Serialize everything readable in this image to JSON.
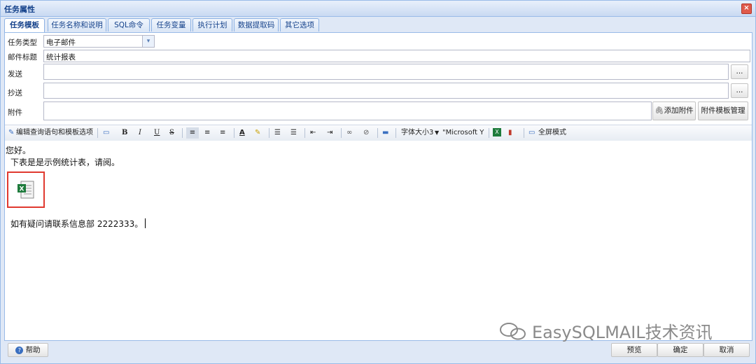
{
  "window": {
    "title": "任务属性",
    "close_icon": "close-icon"
  },
  "tabs": [
    {
      "label": "任务模板",
      "active": true
    },
    {
      "label": "任务名称和说明"
    },
    {
      "label": "SQL命令"
    },
    {
      "label": "任务变量"
    },
    {
      "label": "执行计划"
    },
    {
      "label": "数据提取码"
    },
    {
      "label": "其它选项"
    }
  ],
  "form": {
    "task_type_label": "任务类型",
    "task_type_value": "电子邮件",
    "subject_label": "邮件标题",
    "subject_value": "统计报表",
    "send_label": "发送",
    "send_value": "",
    "cc_label": "抄送",
    "cc_value": "",
    "attach_label": "附件",
    "attach_value": "",
    "browse_label": "...",
    "add_attachment_label": "添加附件",
    "attachment_template_label": "附件模板管理"
  },
  "toolbar": {
    "edit_query_label": "编辑查询语句和模板选项",
    "bold": "B",
    "italic": "I",
    "underline": "U",
    "strike": "S",
    "text_color": "A",
    "font_size_label": "字体大小3",
    "font_name_label": "\"Microsoft Y",
    "fullscreen_label": "全屏模式"
  },
  "editor": {
    "line1": "您好。",
    "line2": "下表是是示例统计表，请阅。",
    "line3": "如有疑问请联系信息部 2222333。"
  },
  "footer": {
    "help_label": "帮助",
    "preview_label": "预览",
    "ok_label": "确定",
    "cancel_label": "取消"
  },
  "watermark": {
    "text": "EasySQLMAIL技术资讯"
  },
  "colors": {
    "accent": "#15428b",
    "border": "#99bbe8",
    "highlight_box": "#e0392f"
  }
}
